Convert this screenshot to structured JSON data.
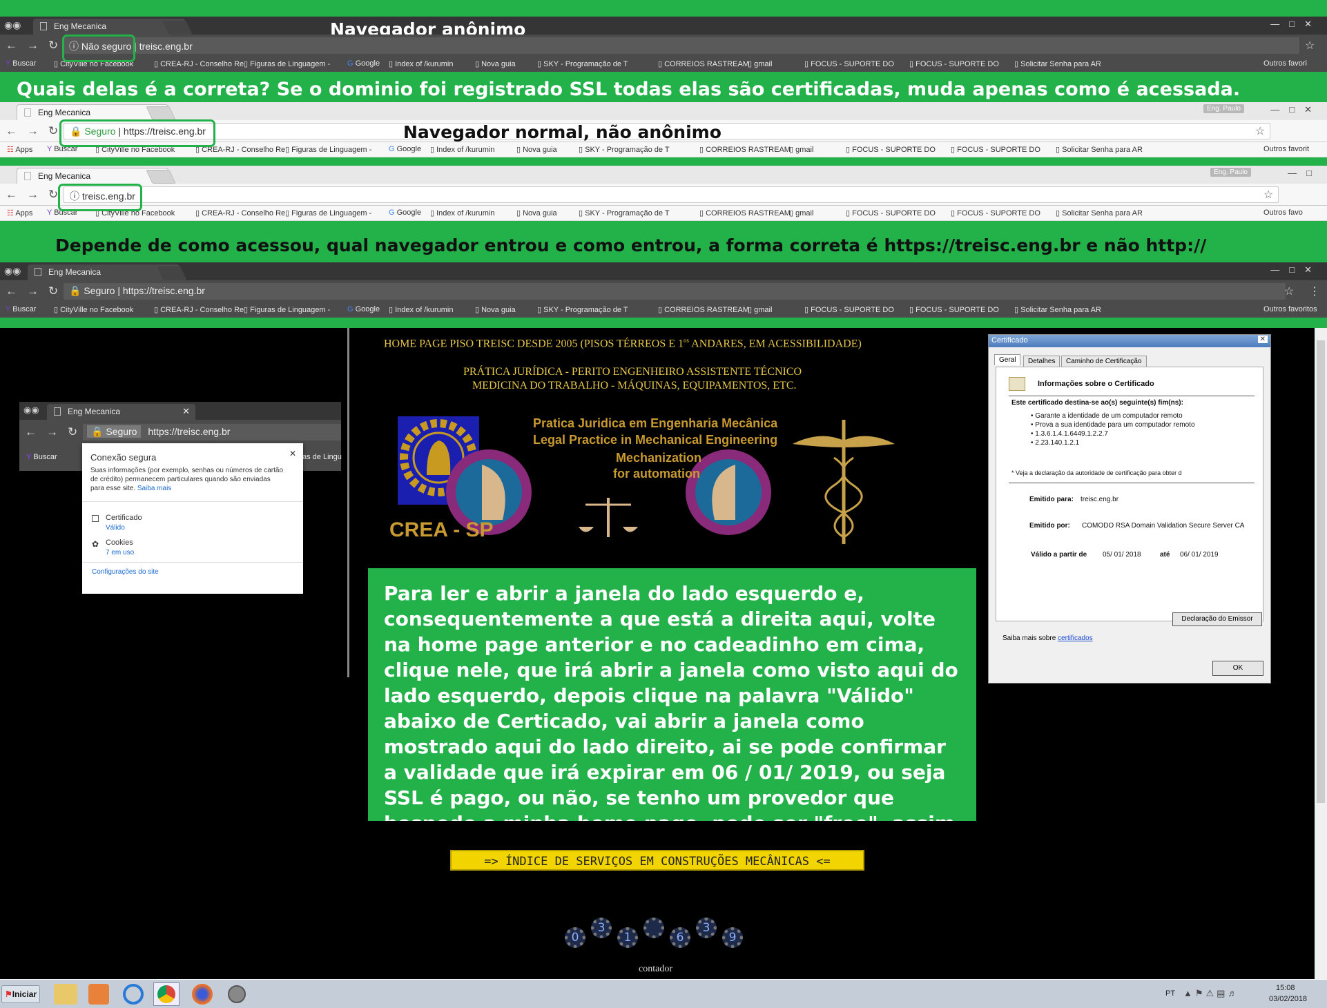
{
  "top_browser": {
    "tab_title": "Eng Mecanica",
    "label": "Navegador anônimo",
    "security": "Não seguro",
    "url": "treisc.eng.br",
    "bookmarks": [
      "Buscar",
      "CityVille no Facebook",
      "CREA-RJ - Conselho Re",
      "Figuras de Linguagem -",
      "Google",
      "Index of /kurumin",
      "Nova guia",
      "SKY - Programação de T",
      "CORREIOS RASTREAM",
      "gmail",
      "FOCUS - SUPORTE DO",
      "FOCUS - SUPORTE DO",
      "Solicitar Senha para AR"
    ],
    "other_bookmarks": "Outros favori"
  },
  "question_banner": "Quais delas é a correta? Se o dominio foi registrado SSL todas elas são certificadas, muda apenas como é acessada.",
  "normal_browser": {
    "tab_title": "Eng Mecanica",
    "profile": "Eng. Paulo",
    "label": "Navegador normal, não anônimo",
    "security": "Seguro",
    "url": "https://treisc.eng.br",
    "apps": "Apps",
    "bookmarks": [
      "Buscar",
      "CityVille no Facebook",
      "CREA-RJ - Conselho Re",
      "Figuras de Linguagem -",
      "Google",
      "Index of /kurumin",
      "Nova guia",
      "SKY - Programação de T",
      "CORREIOS RASTREAM",
      "gmail",
      "FOCUS - SUPORTE DO",
      "FOCUS - SUPORTE DO",
      "Solicitar Senha para AR"
    ],
    "other_bookmarks": "Outros favorit"
  },
  "third_browser": {
    "tab_title": "Eng Mecanica",
    "profile": "Eng. Paulo",
    "url": "treisc.eng.br",
    "apps": "Apps",
    "bookmarks": [
      "Buscar",
      "CityVille no Facebook",
      "CREA-RJ - Conselho Re",
      "Figuras de Linguagem -",
      "Google",
      "Index of /kurumin",
      "Nova guia",
      "SKY - Programação de T",
      "CORREIOS RASTREAM",
      "gmail",
      "FOCUS - SUPORTE DO",
      "FOCUS - SUPORTE DO",
      "Solicitar Senha para AR"
    ],
    "other_bookmarks": "Outros favo"
  },
  "depends_banner": "Depende de como acessou, qual navegador entrou e como entrou, a forma correta é https://treisc.eng.br e não http://",
  "main_browser": {
    "tab_title": "Eng Mecanica",
    "security": "Seguro",
    "url": "https://treisc.eng.br",
    "bookmarks": [
      "Buscar",
      "CityVille no Facebook",
      "CREA-RJ - Conselho Re",
      "Figuras de Linguagem -",
      "Google",
      "Index of /kurumin",
      "Nova guia",
      "SKY - Programação de T",
      "CORREIOS RASTREAM",
      "gmail",
      "FOCUS - SUPORTE DO",
      "FOCUS - SUPORTE DO",
      "Solicitar Senha para AR"
    ],
    "other_bookmarks": "Outros favoritos"
  },
  "site": {
    "headline1": "HOME PAGE PISO TREISC DESDE 2005 (PISOS TÉRREOS E 1",
    "headline1_sup": "os",
    "headline1_end": " ANDARES, EM ACESSIBILIDADE)",
    "headline2": "PRÁTICA JURÍDICA - PERITO ENGENHEIRO ASSISTENTE TÉCNICO",
    "headline3": "MEDICINA DO TRABALHO - MÁQUINAS, EQUIPAMENTOS, ETC.",
    "crea": "CREA - SP",
    "banner_line1": "Pratica Juridica em Engenharia Mecânica",
    "banner_line2": "Legal Practice in Mechanical Engineering",
    "banner_line3": "Mechanization",
    "banner_line4": "for automation",
    "explanation": "Para ler e abrir a janela do lado esquerdo e, consequentemente a que está a direita aqui, volte na home page anterior e no cadeadinho em cima, clique nele, que irá abrir a janela como visto aqui do lado esquerdo, depois clique na palavra \"Válido\" abaixo de  Certicado, vai abrir a janela como mostrado aqui do lado direito, ai se pode confirmar a validade que irá expirar em 06 / 01/ 2019, ou seja SSL é pago, ou não, se tenho um provedor que hospedo a minha home page, pode ser \"free\", assim é meu site seguro",
    "index_button": "=> ÍNDICE DE SERVIÇOS EM CONSTRUÇÕES MECÂNICAS <=",
    "counter_digits": [
      "0",
      "3",
      "1",
      "",
      "6",
      "3",
      "9"
    ],
    "counter_label": "contador"
  },
  "popup_browser": {
    "tab_title": "Eng Mecanica",
    "security": "Seguro",
    "url": "https://treisc.eng.br",
    "bookmark": "Buscar",
    "bookmark_tail": "as de Lingu"
  },
  "site_info": {
    "title": "Conexão segura",
    "body": "Suas informações (por exemplo, senhas ou números de cartão de crédito) permanecem particulares quando são enviadas para esse site.",
    "learn_more": "Saiba mais",
    "cert_label": "Certificado",
    "cert_value": "Válido",
    "cookies_label": "Cookies",
    "cookies_value": "7 em uso",
    "settings": "Configurações do site"
  },
  "certificate": {
    "window_title": "Certificado",
    "tabs": [
      "Geral",
      "Detalhes",
      "Caminho de Certificação"
    ],
    "heading": "Informações sobre o Certificado",
    "purpose_title": "Este certificado destina-se ao(s) seguinte(s) fim(ns):",
    "purposes": [
      "• Garante a identidade de um computador remoto",
      "• Prova a sua identidade para um computador remoto",
      "• 1.3.6.1.4.1.6449.1.2.2.7",
      "• 2.23.140.1.2.1"
    ],
    "note": "* Veja a declaração da autoridade de certificação para obter d",
    "issued_to_label": "Emitido para:",
    "issued_to": "treisc.eng.br",
    "issued_by_label": "Emitido por:",
    "issued_by": "COMODO RSA Domain Validation Secure Server CA",
    "valid_label": "Válido a partir de",
    "valid_from": "05/ 01/ 2018",
    "until_label": "até",
    "valid_to": "06/ 01/ 2019",
    "issuer_button": "Declaração do Emissor",
    "more_text": "Saiba mais sobre",
    "more_link": "certificados",
    "ok_button": "OK"
  },
  "taskbar": {
    "start": "Iniciar",
    "lang": "PT",
    "time": "15:08",
    "date": "03/02/2018"
  },
  "colors": {
    "banner_green": "#23b24a",
    "site_yellow": "#e8c84a",
    "explanation_bg": "#23b24a",
    "index_button_bg": "#f2d500"
  }
}
